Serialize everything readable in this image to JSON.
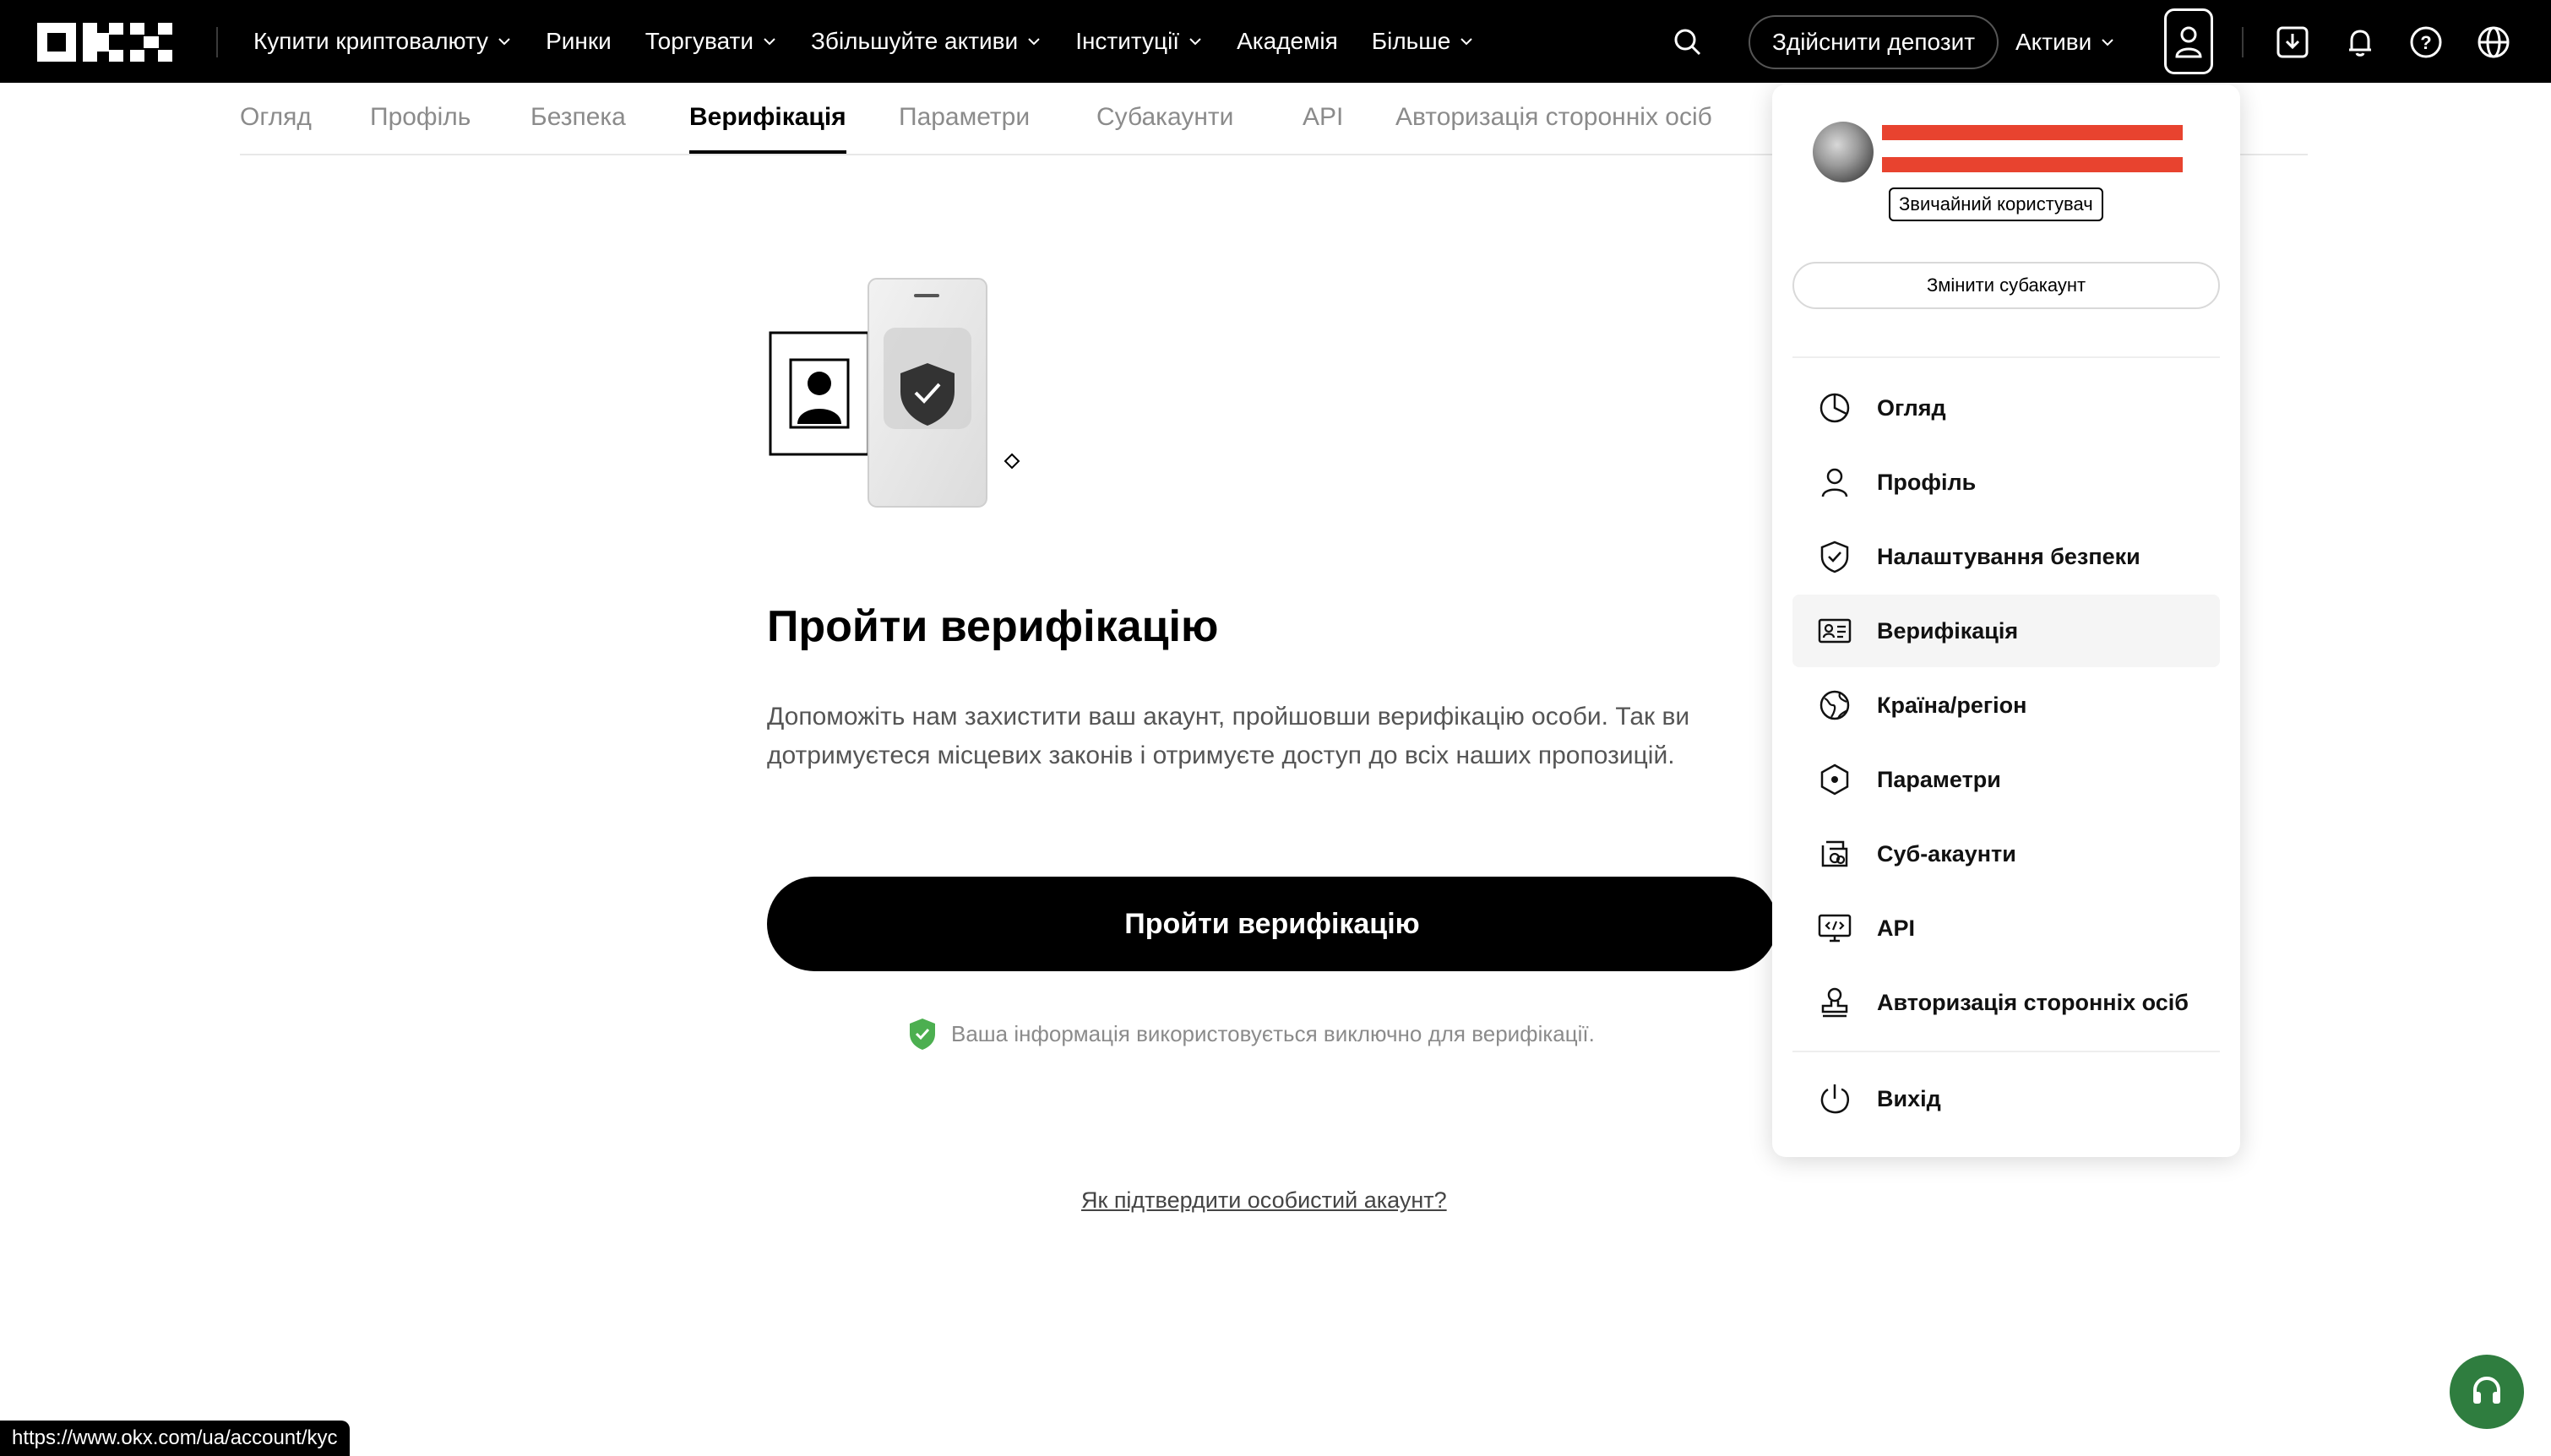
{
  "header": {
    "nav": [
      {
        "label": "Купити криптовалюту",
        "has_dropdown": true
      },
      {
        "label": "Ринки",
        "has_dropdown": false
      },
      {
        "label": "Торгувати",
        "has_dropdown": true
      },
      {
        "label": "Збільшуйте активи",
        "has_dropdown": true
      },
      {
        "label": "Інституції",
        "has_dropdown": true
      },
      {
        "label": "Академія",
        "has_dropdown": false
      },
      {
        "label": "Більше",
        "has_dropdown": true
      }
    ],
    "deposit_label": "Здійснити депозит",
    "assets_label": "Активи"
  },
  "subtabs": [
    {
      "label": "Огляд"
    },
    {
      "label": "Профіль"
    },
    {
      "label": "Безпека"
    },
    {
      "label": "Верифікація",
      "active": true
    },
    {
      "label": "Параметри"
    },
    {
      "label": "Субакаунти"
    },
    {
      "label": "API"
    },
    {
      "label": "Авторизація сторонніх осіб"
    }
  ],
  "main": {
    "title": "Пройти верифікацію",
    "description": "Допоможіть нам захистити ваш акаунт, пройшовши верифікацію особи. Так ви дотримуєтеся місцевих законів і отримуєте доступ до всіх наших пропозицій.",
    "button_label": "Пройти верифікацію",
    "privacy_note": "Ваша інформація використовується виключно для верифікації.",
    "help_link": "Як підтвердити особистий акаунт?"
  },
  "dropdown": {
    "user_badge": "Звичайний користувач",
    "switch_subaccount": "Змінити субакаунт",
    "items": [
      {
        "label": "Огляд",
        "icon": "pie-chart-icon"
      },
      {
        "label": "Профіль",
        "icon": "person-icon"
      },
      {
        "label": "Налаштування безпеки",
        "icon": "shield-check-icon"
      },
      {
        "label": "Верифікація",
        "icon": "id-card-icon",
        "active": true
      },
      {
        "label": "Країна/регіон",
        "icon": "globe-region-icon"
      },
      {
        "label": "Параметри",
        "icon": "hexagon-settings-icon"
      },
      {
        "label": "Суб-акаунти",
        "icon": "sub-accounts-icon"
      },
      {
        "label": "API",
        "icon": "api-code-icon"
      },
      {
        "label": "Авторизація сторонніх осіб",
        "icon": "authorization-stamp-icon"
      }
    ],
    "logout_label": "Вихід"
  },
  "status_bar": {
    "url": "https://www.okx.com/ua/account/kyc"
  },
  "colors": {
    "topbar": "#000000",
    "primary_button": "#000000",
    "redaction": "#e8432f",
    "shield_green": "#4caf50",
    "support_green": "#2f7d3f"
  }
}
